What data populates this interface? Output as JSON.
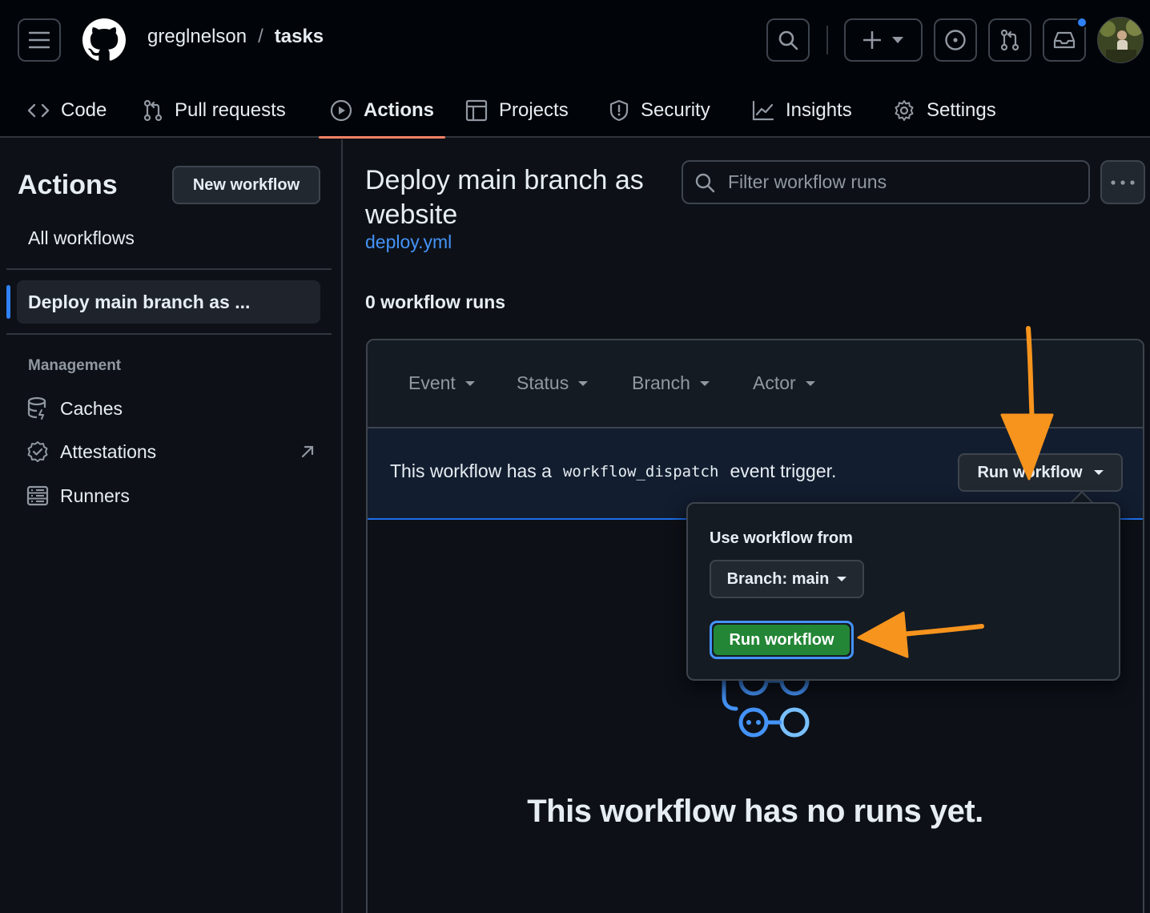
{
  "header": {
    "owner": "greglnelson",
    "separator": "/",
    "repo": "tasks"
  },
  "tabs": [
    {
      "label": "Code",
      "icon": "code-icon"
    },
    {
      "label": "Pull requests",
      "icon": "git-pull-request-icon"
    },
    {
      "label": "Actions",
      "icon": "play-icon",
      "active": true
    },
    {
      "label": "Projects",
      "icon": "table-icon"
    },
    {
      "label": "Security",
      "icon": "shield-icon"
    },
    {
      "label": "Insights",
      "icon": "graph-icon"
    },
    {
      "label": "Settings",
      "icon": "gear-icon"
    }
  ],
  "sidebar": {
    "title": "Actions",
    "new_workflow": "New workflow",
    "all_workflows": "All workflows",
    "selected_workflow": "Deploy main branch as ...",
    "management_heading": "Management",
    "management_items": [
      {
        "label": "Caches",
        "icon": "database-icon"
      },
      {
        "label": "Attestations",
        "icon": "verified-icon"
      },
      {
        "label": "Runners",
        "icon": "server-icon"
      }
    ]
  },
  "main": {
    "title": "Deploy main branch as website",
    "file": "deploy.yml",
    "filter_placeholder": "Filter workflow runs",
    "runs_count": "0 workflow runs",
    "filters": [
      "Event",
      "Status",
      "Branch",
      "Actor"
    ],
    "dispatch_prefix": "This workflow has a",
    "dispatch_code": "workflow_dispatch",
    "dispatch_suffix": "event trigger.",
    "run_workflow_dropdown": "Run workflow",
    "empty_title": "This workflow has no runs yet."
  },
  "popover": {
    "title": "Use workflow from",
    "branch_button": "Branch: main",
    "run_button": "Run workflow"
  },
  "colors": {
    "annotation_arrow": "#f7941d",
    "accent_blue": "#2f81f7",
    "run_green": "#238636",
    "active_tab_underline": "#f78166"
  }
}
